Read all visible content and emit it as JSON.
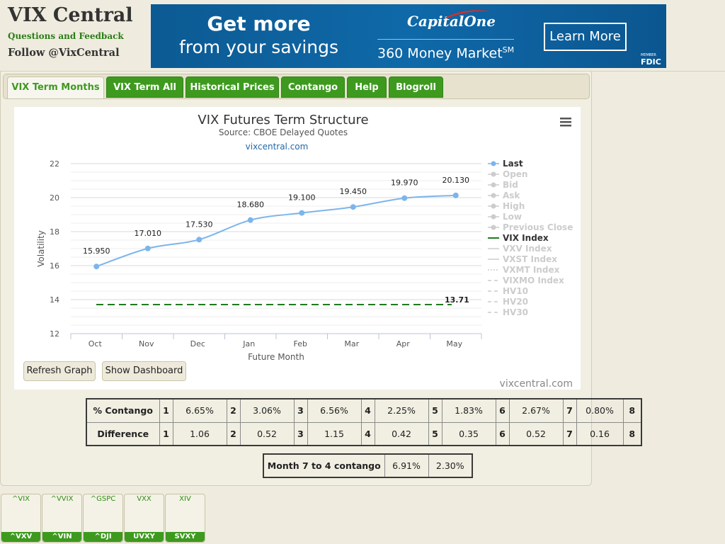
{
  "header": {
    "site_title": "VIX Central",
    "feedback_link": "Questions and Feedback",
    "follow_link": "Follow @VixCentral"
  },
  "ad": {
    "headline_line1": "Get more",
    "headline_line2": "from your savings",
    "brand": "CapitalOne",
    "product": "360 Money Market",
    "product_mark": "SM",
    "button": "Learn More",
    "fdic_small": "MEMBER",
    "fdic": "FDIC"
  },
  "tabs": [
    {
      "label": "VIX Term Months",
      "active": true
    },
    {
      "label": "VIX Term All"
    },
    {
      "label": "Historical Prices"
    },
    {
      "label": "Contango"
    },
    {
      "label": "Help"
    },
    {
      "label": "Blogroll"
    }
  ],
  "buttons": {
    "refresh": "Refresh Graph",
    "dashboard": "Show Dashboard"
  },
  "chart_data": {
    "type": "line",
    "title": "VIX Futures Term Structure",
    "subtitle": "Source: CBOE Delayed Quotes",
    "site_label": "vixcentral.com",
    "watermark": "vixcentral.com",
    "xlabel": "Future Month",
    "ylabel": "Volatility",
    "categories": [
      "Oct",
      "Nov",
      "Dec",
      "Jan",
      "Feb",
      "Mar",
      "Apr",
      "May"
    ],
    "ylim": [
      12,
      22
    ],
    "yticks": [
      12,
      14,
      16,
      18,
      20,
      22
    ],
    "grid": true,
    "legend_position": "right",
    "series": [
      {
        "name": "Last",
        "values": [
          15.95,
          17.01,
          17.53,
          18.68,
          19.1,
          19.45,
          19.97,
          20.13
        ],
        "labels": [
          "15.950",
          "17.010",
          "17.530",
          "18.680",
          "19.100",
          "19.450",
          "19.970",
          "20.130"
        ],
        "color": "#7cb5ec"
      },
      {
        "name": "VIX Index",
        "value": 13.71,
        "label": "13.71",
        "color": "#1f7a1f",
        "dashed": true
      }
    ],
    "legend": [
      {
        "name": "Last",
        "enabled": true
      },
      {
        "name": "Open",
        "enabled": false
      },
      {
        "name": "Bid",
        "enabled": false
      },
      {
        "name": "Ask",
        "enabled": false
      },
      {
        "name": "High",
        "enabled": false
      },
      {
        "name": "Low",
        "enabled": false
      },
      {
        "name": "Previous Close",
        "enabled": false
      },
      {
        "name": "VIX Index",
        "enabled": true
      },
      {
        "name": "VXV Index",
        "enabled": false
      },
      {
        "name": "VXST Index",
        "enabled": false
      },
      {
        "name": "VXMT Index",
        "enabled": false
      },
      {
        "name": "VIXMO Index",
        "enabled": false
      },
      {
        "name": "HV10",
        "enabled": false
      },
      {
        "name": "HV20",
        "enabled": false
      },
      {
        "name": "HV30",
        "enabled": false
      }
    ]
  },
  "contango_table": {
    "rows": [
      {
        "label": "% Contango",
        "months": [
          "1",
          "2",
          "3",
          "4",
          "5",
          "6",
          "7",
          "8"
        ],
        "values": [
          "6.65%",
          "3.06%",
          "6.56%",
          "2.25%",
          "1.83%",
          "2.67%",
          "0.80%"
        ]
      },
      {
        "label": "Difference",
        "months": [
          "1",
          "2",
          "3",
          "4",
          "5",
          "6",
          "7",
          "8"
        ],
        "values": [
          "1.06",
          "0.52",
          "1.15",
          "0.42",
          "0.35",
          "0.52",
          "0.16"
        ]
      }
    ]
  },
  "month74": {
    "label": "Month 7 to 4 contango",
    "value1": "6.91%",
    "value2": "2.30%"
  },
  "tickers": [
    {
      "top": "^VIX",
      "bottom": "^VXV"
    },
    {
      "top": "^VVIX",
      "bottom": "^VIN"
    },
    {
      "top": "^GSPC",
      "bottom": "^DJI"
    },
    {
      "top": "VXX",
      "bottom": "UVXY"
    },
    {
      "top": "XIV",
      "bottom": "SVXY"
    }
  ]
}
